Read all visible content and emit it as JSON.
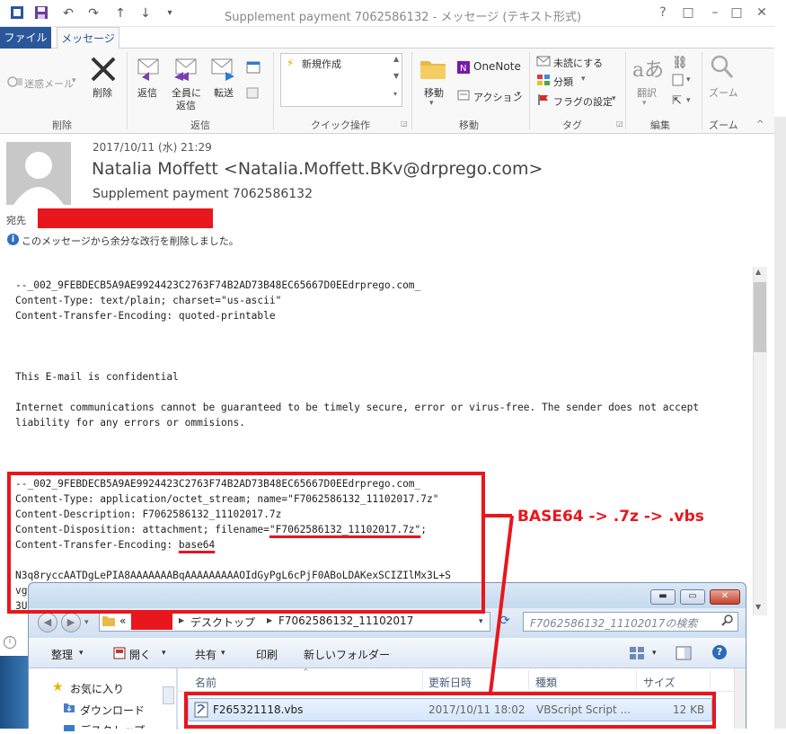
{
  "window": {
    "title": "Supplement payment 7062586132 - メッセージ (テキスト形式)",
    "controls": [
      "?",
      "□",
      "–",
      "□",
      "✕"
    ]
  },
  "tabs": {
    "file": "ファイル",
    "message": "メッセージ"
  },
  "ribbon": {
    "delete_group": {
      "junk": "迷惑メール",
      "delete": "削除",
      "label": "削除"
    },
    "reply_group": {
      "reply": "返信",
      "reply_all_1": "全員に",
      "reply_all_2": "返信",
      "forward": "転送",
      "label": "返信"
    },
    "quick_group": {
      "new": "新規作成",
      "label": "クイック操作"
    },
    "move_group": {
      "move": "移動",
      "onenote": "OneNote",
      "actions": "アクション",
      "label": "移動"
    },
    "tags_group": {
      "unread": "未読にする",
      "categorize": "分類",
      "followup": "フラグの設定",
      "label": "タグ"
    },
    "edit_group": {
      "translate": "翻訳",
      "label": "編集"
    },
    "zoom_group": {
      "zoom": "ズーム",
      "label": "ズーム"
    }
  },
  "message": {
    "date": "2017/10/11 (水) 21:29",
    "sender": "Natalia Moffett <Natalia.Moffett.BKv@drprego.com>",
    "subject": "Supplement payment 7062586132",
    "to_label": "宛先",
    "info": "このメッセージから余分な改行を削除しました。"
  },
  "body_lines": {
    "l1": "--_002_9FEBDECB5A9AE9924423C2763F74B2AD73B48EC65667D0EEdrprego.com_",
    "l2": "Content-Type: text/plain; charset=\"us-ascii\"",
    "l3": "Content-Transfer-Encoding: quoted-printable",
    "l4": "This E-mail is confidential",
    "l5": "Internet communications cannot be guaranteed to be timely secure, error or virus-free. The sender does not accept",
    "l6": "liability for any errors or ommisions.",
    "l7": "--_002_9FEBDECB5A9AE9924423C2763F74B2AD73B48EC65667D0EEdrprego.com_",
    "l8": "Content-Type: application/octet_stream; name=\"F7062586132_11102017.7z\"",
    "l9": "Content-Description: F7062586132_11102017.7z",
    "l10a": "Content-Disposition: attachment; filename=",
    "l10b": "\"F7062586132_11102017.7z\"",
    "l10c": ";",
    "l11a": "Content-Transfer-Encoding: ",
    "l11b": "base64",
    "l12": "N3q8ryccAATDgLePIA8AAAAAAABqAAAAAAAAAOIdGyPgL6cPjF0ABoLDAKexSCIZIlMx3L+S",
    "l13": "vg",
    "l14": "3U"
  },
  "annotation": "BASE64 -> .7z -> .vbs",
  "explorer": {
    "breadcrumb": [
      "«",
      "デスクトップ",
      "F7062586132_11102017"
    ],
    "search_placeholder": "F7062586132_11102017の検索",
    "toolbar": {
      "organize": "整理",
      "open": "開く",
      "share": "共有",
      "print": "印刷",
      "new_folder": "新しいフォルダー"
    },
    "nav": {
      "favorites": "お気に入り",
      "downloads": "ダウンロード",
      "desktop": "デスクトップ"
    },
    "columns": {
      "name": "名前",
      "modified": "更新日時",
      "type": "種類",
      "size": "サイズ"
    },
    "file": {
      "name": "F265321118.vbs",
      "modified": "2017/10/11 18:02",
      "type": "VBScript Script ...",
      "size": "12 KB"
    }
  },
  "colors": {
    "accent": "#2b579a",
    "redact": "#e8161d",
    "explorer_frame": "#cfe0f3"
  }
}
